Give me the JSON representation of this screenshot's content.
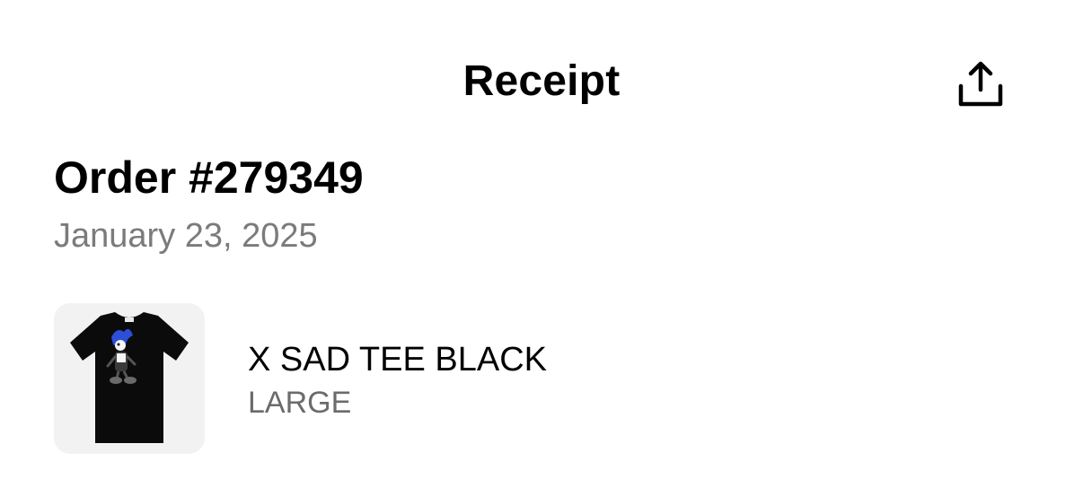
{
  "header": {
    "title": "Receipt",
    "share_icon": "share-icon"
  },
  "order": {
    "number": "Order #279349",
    "date": "January 23, 2025"
  },
  "items": [
    {
      "name": "X SAD TEE BLACK",
      "variant": "LARGE",
      "image": "black-tshirt-image"
    }
  ]
}
